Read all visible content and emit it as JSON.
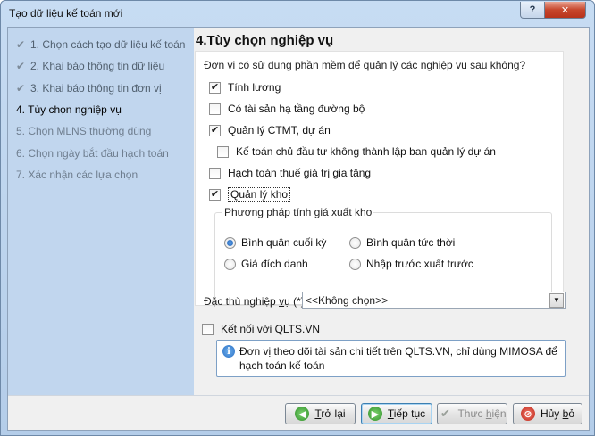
{
  "window": {
    "title": "Tạo dữ liệu kế toán mới",
    "help_label": "?",
    "close_label": "✕"
  },
  "steps": [
    {
      "label": "1. Chọn cách tạo dữ liệu kế toán",
      "state": "done"
    },
    {
      "label": "2. Khai báo thông tin dữ liệu",
      "state": "done"
    },
    {
      "label": "3. Khai báo thông tin đơn vị",
      "state": "done"
    },
    {
      "label": "4. Tùy chọn nghiệp vụ",
      "state": "current"
    },
    {
      "label": "5. Chọn MLNS thường dùng",
      "state": "pending"
    },
    {
      "label": "6. Chọn ngày bắt đầu hạch toán",
      "state": "pending"
    },
    {
      "label": "7. Xác nhận các lựa chọn",
      "state": "pending"
    }
  ],
  "main": {
    "title": "4.Tùy chọn nghiệp vụ",
    "question": "Đơn vị có sử dụng phần mềm để quản lý các nghiệp vụ sau không?",
    "options": [
      {
        "label": "Tính lương",
        "checked": true
      },
      {
        "label": "Có tài sản hạ tầng đường bộ",
        "checked": false
      },
      {
        "label": "Quản lý CTMT, dự án",
        "checked": true
      },
      {
        "label": "Kế toán chủ đầu tư không thành lập ban quản lý dự án",
        "checked": false
      },
      {
        "label": "Hạch toán thuế giá trị gia tăng",
        "checked": false
      },
      {
        "label": "Quản lý kho",
        "checked": true
      }
    ],
    "valuation_group": {
      "title": "Phương pháp tính giá xuất kho",
      "options": [
        {
          "label": "Bình quân cuối kỳ",
          "selected": true
        },
        {
          "label": "Bình quân tức thời",
          "selected": false
        },
        {
          "label": "Giá đích danh",
          "selected": false
        },
        {
          "label": "Nhập trước xuất trước",
          "selected": false
        }
      ]
    },
    "industry": {
      "label_prefix": "Đặc thù nghiệp ",
      "label_hotkey": "v",
      "label_suffix": "ụ (*)",
      "value": "<<Không chọn>>"
    },
    "qlts": {
      "label": "Kết nối với QLTS.VN",
      "checked": false,
      "info": "Đơn vị theo dõi tài sản chi tiết trên QLTS.VN, chỉ dùng MIMOSA để hạch toán kế toán"
    }
  },
  "buttons": {
    "back": {
      "hotkey": "T",
      "rest": "rở lại"
    },
    "next": {
      "hotkey": "T",
      "rest": "iếp tục"
    },
    "finish": {
      "pre": "Thực ",
      "hotkey": "h",
      "rest": "iện"
    },
    "cancel": {
      "pre": "Hủy ",
      "hotkey": "b",
      "rest": "ỏ"
    }
  },
  "colors": {
    "sidebar_bg": "#c1d6ee",
    "title_bar": "#c7dcf3",
    "close_button": "#c7462c"
  },
  "icons": {
    "step_done": "checkmark-icon",
    "back": "arrow-left-icon",
    "next": "arrow-right-icon",
    "finish": "check-icon",
    "cancel": "no-entry-icon",
    "info": "info-icon",
    "combo": "chevron-down-icon"
  }
}
